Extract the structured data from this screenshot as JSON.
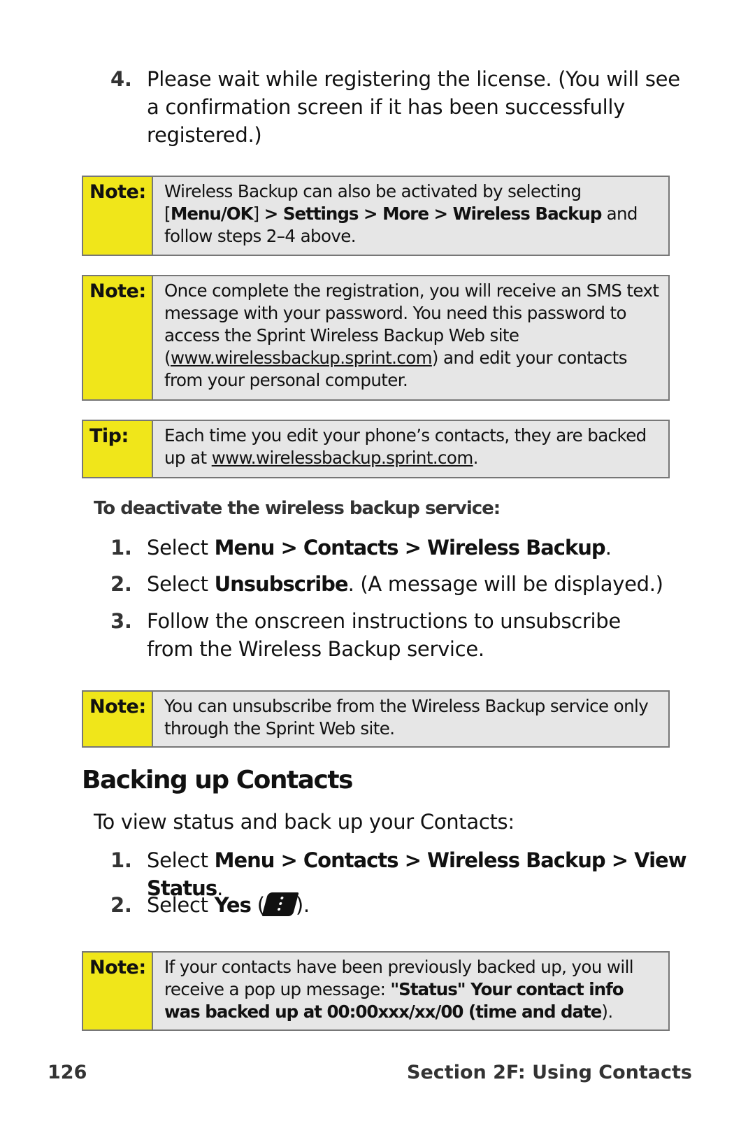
{
  "top_step": {
    "num": "4.",
    "segments": [
      {
        "t": "Please wait while registering the license. (You will see a confirmation screen if it has been successfully registered.)"
      }
    ]
  },
  "boxes": [
    {
      "label": "Note:",
      "segments": [
        {
          "t": "Wireless Backup can also be activated by selecting "
        },
        {
          "t": "["
        },
        {
          "t": "Menu/OK",
          "b": true
        },
        {
          "t": "] "
        },
        {
          "t": "> Settings > More > Wireless Backup",
          "b": true
        },
        {
          "t": " and follow steps 2–4 above."
        }
      ]
    },
    {
      "label": "Note:",
      "segments": [
        {
          "t": "Once complete the registration, you will receive an SMS text message with your password. You need this password to access the Sprint Wireless Backup Web site ("
        },
        {
          "t": "www.wirelessbackup.sprint.com",
          "u": true
        },
        {
          "t": ") and edit your contacts from your personal computer."
        }
      ]
    },
    {
      "label": "Tip:",
      "segments": [
        {
          "t": "Each time you edit your phone’s contacts, they are backed up at "
        },
        {
          "t": "www.wirelessbackup.sprint.com",
          "u": true
        },
        {
          "t": "."
        }
      ]
    },
    {
      "label": "Note:",
      "segments": [
        {
          "t": "You can unsubscribe from the Wireless Backup service only through the Sprint Web site."
        }
      ]
    },
    {
      "label": "Note:",
      "segments": [
        {
          "t": "If your contacts have been previously backed up, you will receive a pop up message: "
        },
        {
          "t": "\"Status\"  Your contact info was backed up at 00:00xxx/xx/00 (time and date",
          "b": true
        },
        {
          "t": ")."
        }
      ]
    }
  ],
  "deactivate": {
    "heading": "To deactivate the wireless backup service:",
    "steps": [
      {
        "num": "1.",
        "segments": [
          {
            "t": "Select "
          },
          {
            "t": "Menu > Contacts > Wireless Backup",
            "b": true
          },
          {
            "t": "."
          }
        ]
      },
      {
        "num": "2.",
        "segments": [
          {
            "t": "Select "
          },
          {
            "t": "Unsubscribe",
            "b": true
          },
          {
            "t": ". (A message will be displayed.)"
          }
        ]
      },
      {
        "num": "3.",
        "segments": [
          {
            "t": "Follow the onscreen instructions to unsubscribe from the Wireless Backup service."
          }
        ]
      }
    ]
  },
  "backup": {
    "heading": "Backing up Contacts",
    "intro": "To view status and back up your Contacts:",
    "steps": [
      {
        "num": "1.",
        "segments": [
          {
            "t": "Select "
          },
          {
            "t": "Menu > Contacts > Wireless Backup > View Status",
            "b": true
          },
          {
            "t": "."
          }
        ]
      },
      {
        "num": "2.",
        "segments": [
          {
            "t": "Select "
          },
          {
            "t": "Yes",
            "b": true
          },
          {
            "t": " ("
          },
          {
            "icon": "softkey-icon"
          },
          {
            "t": ")."
          }
        ]
      }
    ]
  },
  "footer": {
    "page": "126",
    "section": "Section 2F: Using Contacts"
  },
  "colors": {
    "label_bg": "#f0e61a",
    "box_bg": "#e6e6e6",
    "border": "#777777"
  }
}
